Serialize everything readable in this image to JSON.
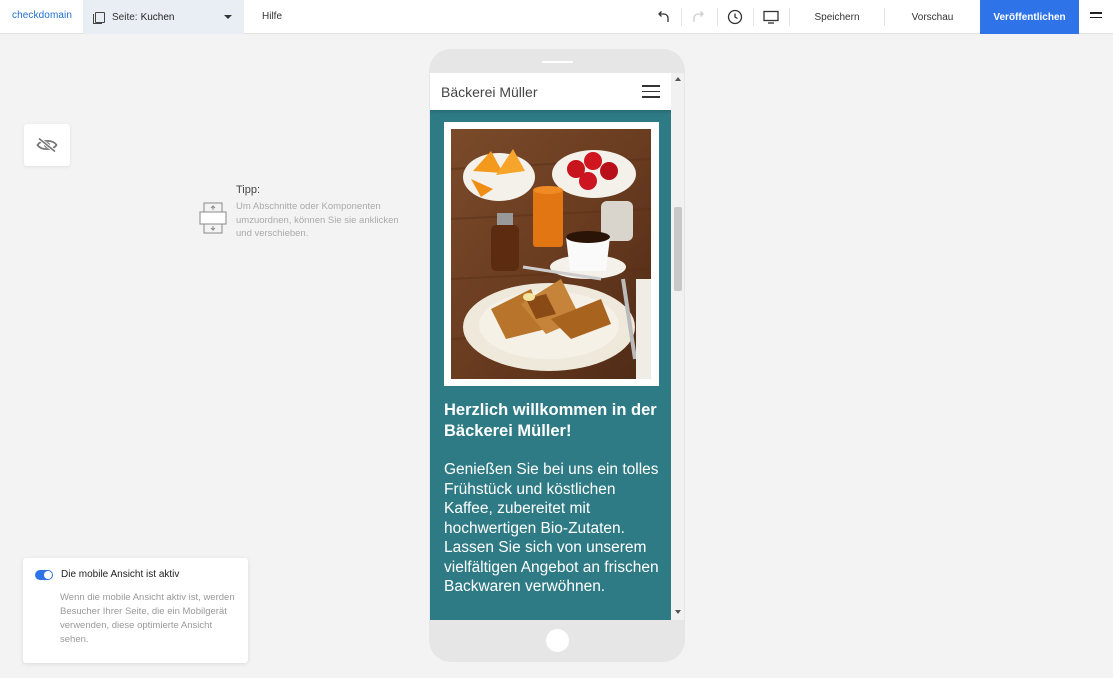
{
  "topbar": {
    "logo": "checkdomain",
    "page_prefix": "Seite:",
    "page_name": "Kuchen",
    "help_label": "Hilfe",
    "save_label": "Speichern",
    "preview_label": "Vorschau",
    "publish_label": "Veröffentlichen",
    "icons": [
      "undo-icon",
      "redo-icon",
      "history-icon",
      "desktop-icon",
      "menu-icon"
    ],
    "publish_color": "#2e73e8"
  },
  "tip": {
    "title": "Tipp:",
    "text": "Um Abschnitte oder Komponenten umzuordnen, können Sie sie anklicken und verschieben."
  },
  "mobile_notice": {
    "title": "Die mobile Ansicht ist aktiv",
    "text": "Wenn die mobile Ansicht aktiv ist, werden Besucher Ihrer Seite, die ein Mobilgerät verwenden, diese optimierte Ansicht sehen.",
    "toggle_on": true
  },
  "site": {
    "name": "Bäckerei Müller",
    "hero_title": "Herzlich willkommen in der Bäckerei Müller!",
    "hero_text": "Genießen Sie bei uns ein tolles Frühstück und köstlichen Kaffee, zubereitet mit hochwertigen Bio-Zutaten. Lassen Sie sich von unserem vielfältigen Angebot an frischen Backwaren verwöhnen.",
    "theme_color": "#2f7b85"
  }
}
